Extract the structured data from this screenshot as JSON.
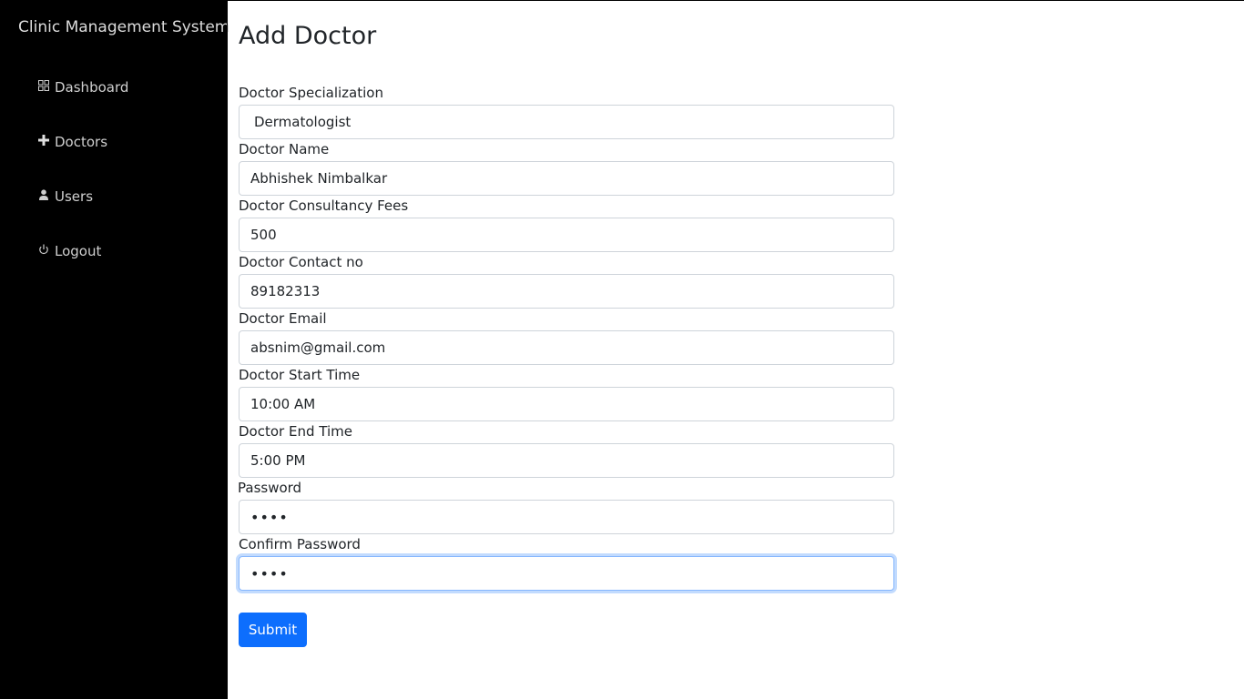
{
  "sidebar": {
    "brand": "Clinic Management System",
    "items": [
      {
        "label": "Dashboard",
        "icon": "grid-icon"
      },
      {
        "label": "Doctors",
        "icon": "plus-icon"
      },
      {
        "label": "Users",
        "icon": "person-icon"
      },
      {
        "label": "Logout",
        "icon": "power-icon"
      }
    ]
  },
  "main": {
    "title": "Add Doctor",
    "fields": [
      {
        "label": "Doctor Specialization",
        "value": "Dermatologist"
      },
      {
        "label": "Doctor Name",
        "value": "Abhishek Nimbalkar"
      },
      {
        "label": "Doctor Consultancy Fees",
        "value": "500"
      },
      {
        "label": "Doctor Contact no",
        "value": "89182313"
      },
      {
        "label": "Doctor Email",
        "value": "absnim@gmail.com"
      },
      {
        "label": "Doctor Start Time",
        "value": "10:00 AM"
      },
      {
        "label": "Doctor End Time",
        "value": "5:00 PM"
      },
      {
        "label": "Password",
        "value": "••••"
      },
      {
        "label": "Confirm Password",
        "value": "••••"
      }
    ],
    "submit_label": "Submit"
  },
  "colors": {
    "sidebar_bg": "#000000",
    "primary": "#0d6efd",
    "focus_border": "#86b7fe"
  }
}
